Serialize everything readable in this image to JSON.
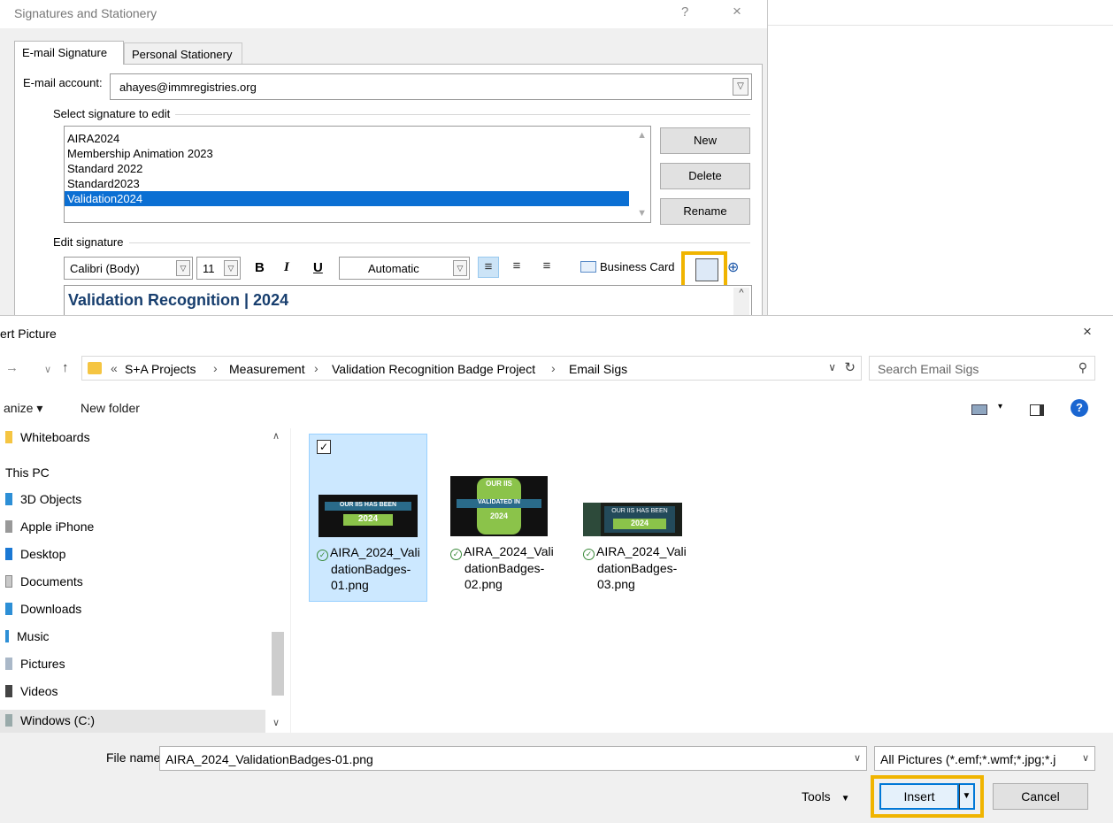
{
  "sig_dialog": {
    "title": "Signatures and Stationery",
    "help": "?",
    "close": "×",
    "tabs": [
      "E-mail Signature",
      "Personal Stationery"
    ],
    "account_label": "E-mail account:",
    "account_value": "ahayes@immregistries.org",
    "select_group_label": "Select signature to edit",
    "signatures": [
      "AIRA2024",
      "Membership Animation 2023",
      "Standard 2022",
      "Standard2023",
      "Validation2024"
    ],
    "selected_signature": "Validation2024",
    "buttons": {
      "new": "New",
      "delete": "Delete",
      "rename": "Rename"
    },
    "edit_group_label": "Edit signature",
    "font": "Calibri (Body)",
    "size": "11",
    "bold": "B",
    "italic": "I",
    "underline": "U",
    "color": "Automatic",
    "business_card": "Business Card",
    "editor_text": "Validation Recognition | 2024",
    "highlight_color": "#f0b400"
  },
  "insert_dialog": {
    "title": "ert Picture",
    "close": "×",
    "breadcrumb_prefix": "«",
    "breadcrumb": [
      "S+A Projects",
      "Measurement",
      "Validation Recognition Badge Project",
      "Email Sigs"
    ],
    "search_placeholder": "Search Email Sigs",
    "organize": "anize ▾",
    "new_folder": "New folder",
    "nav_items": [
      {
        "label": "Whiteboards",
        "icon": "folder-icon"
      },
      {
        "label": "This PC",
        "icon": "pc-icon"
      },
      {
        "label": "3D Objects",
        "icon": "3d-objects-icon"
      },
      {
        "label": "Apple iPhone",
        "icon": "phone-icon"
      },
      {
        "label": "Desktop",
        "icon": "desktop-icon"
      },
      {
        "label": "Documents",
        "icon": "documents-icon"
      },
      {
        "label": "Downloads",
        "icon": "downloads-icon"
      },
      {
        "label": "Music",
        "icon": "music-icon"
      },
      {
        "label": "Pictures",
        "icon": "pictures-icon"
      },
      {
        "label": "Videos",
        "icon": "videos-icon"
      },
      {
        "label": "Windows (C:)",
        "icon": "drive-icon"
      }
    ],
    "files": [
      {
        "name_line1": "AIRA_2024_Vali",
        "name_line2": "dationBadges-",
        "name_line3": "01.png",
        "selected": true,
        "badge_top": "OUR IIS HAS BEEN",
        "badge_year": "2024"
      },
      {
        "name_line1": "AIRA_2024_Vali",
        "name_line2": "dationBadges-",
        "name_line3": "02.png",
        "selected": false,
        "badge_top": "OUR IIS",
        "badge_mid": "VALIDATED IN",
        "badge_year": "2024"
      },
      {
        "name_line1": "AIRA_2024_Vali",
        "name_line2": "dationBadges-",
        "name_line3": "03.png",
        "selected": false,
        "badge_top": "OUR IIS HAS BEEN",
        "badge_year": "2024"
      }
    ],
    "file_name_label": "File name:",
    "file_name_value": "AIRA_2024_ValidationBadges-01.png",
    "filter": "All Pictures (*.emf;*.wmf;*.jpg;*.j",
    "tools": "Tools",
    "insert": "Insert",
    "cancel": "Cancel",
    "checkmark": "✓"
  }
}
